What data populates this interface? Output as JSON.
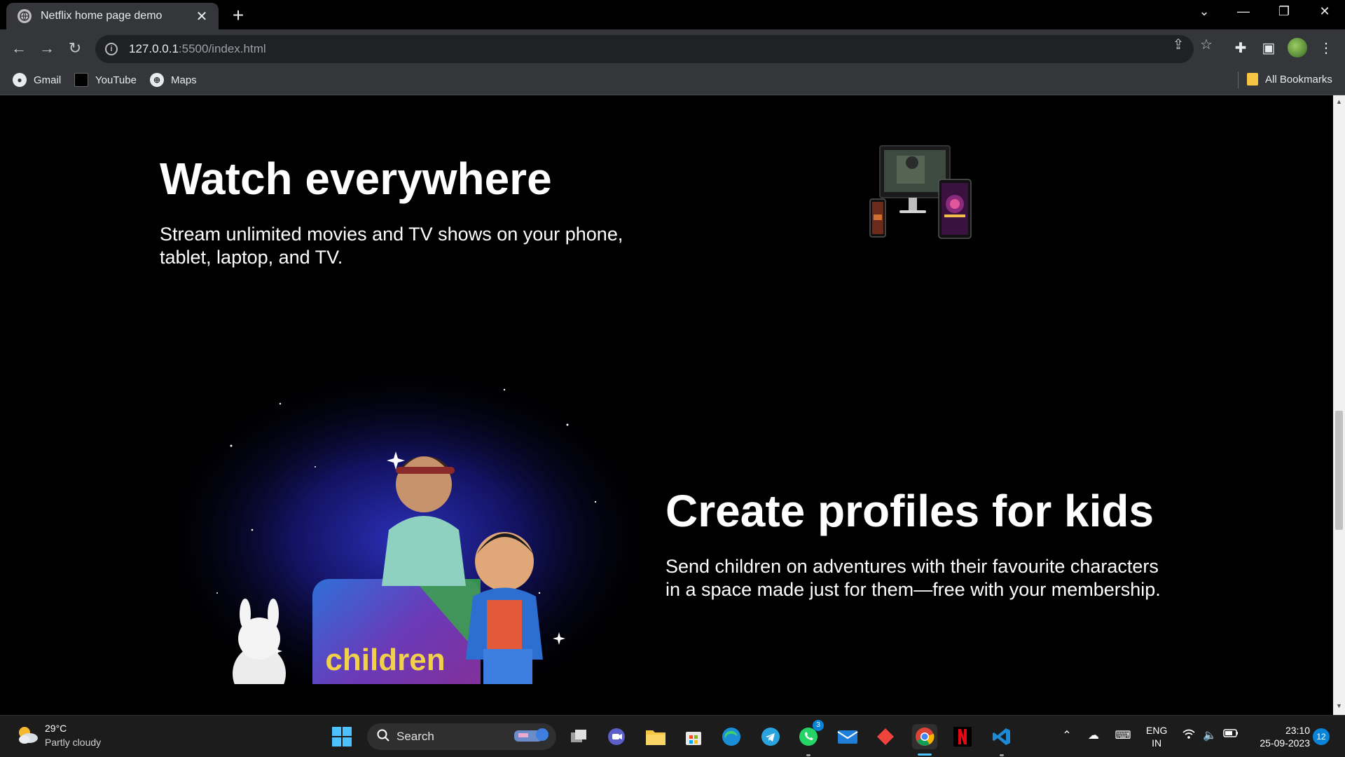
{
  "browser": {
    "tab_title": "Netflix home page demo",
    "url_host": "127.0.0.1",
    "url_path": ":5500/index.html",
    "bookmarks": [
      "Gmail",
      "YouTube",
      "Maps"
    ],
    "all_bookmarks": "All Bookmarks"
  },
  "page": {
    "section1": {
      "title": "Watch everywhere",
      "subtitle_line1": "Stream unlimited movies and TV shows on your phone,",
      "subtitle_line2": "tablet, laptop, and TV."
    },
    "section2": {
      "title": "Create profiles for kids",
      "subtitle_line1": "Send children on adventures with their favourite characters",
      "subtitle_line2": "in a space made just for them—free with your membership.",
      "art_label": "children"
    }
  },
  "taskbar": {
    "weather_temp": "29°C",
    "weather_desc": "Partly cloudy",
    "search_label": "Search",
    "whatsapp_badge": "3",
    "lang_line1": "ENG",
    "lang_line2": "IN",
    "time": "23:10",
    "date": "25-09-2023",
    "notifications": "12"
  },
  "colors": {
    "page_bg": "#000000",
    "chrome_bg": "#35363a",
    "netflix_red": "#e50914",
    "accent_blue": "#4cc2ff"
  }
}
